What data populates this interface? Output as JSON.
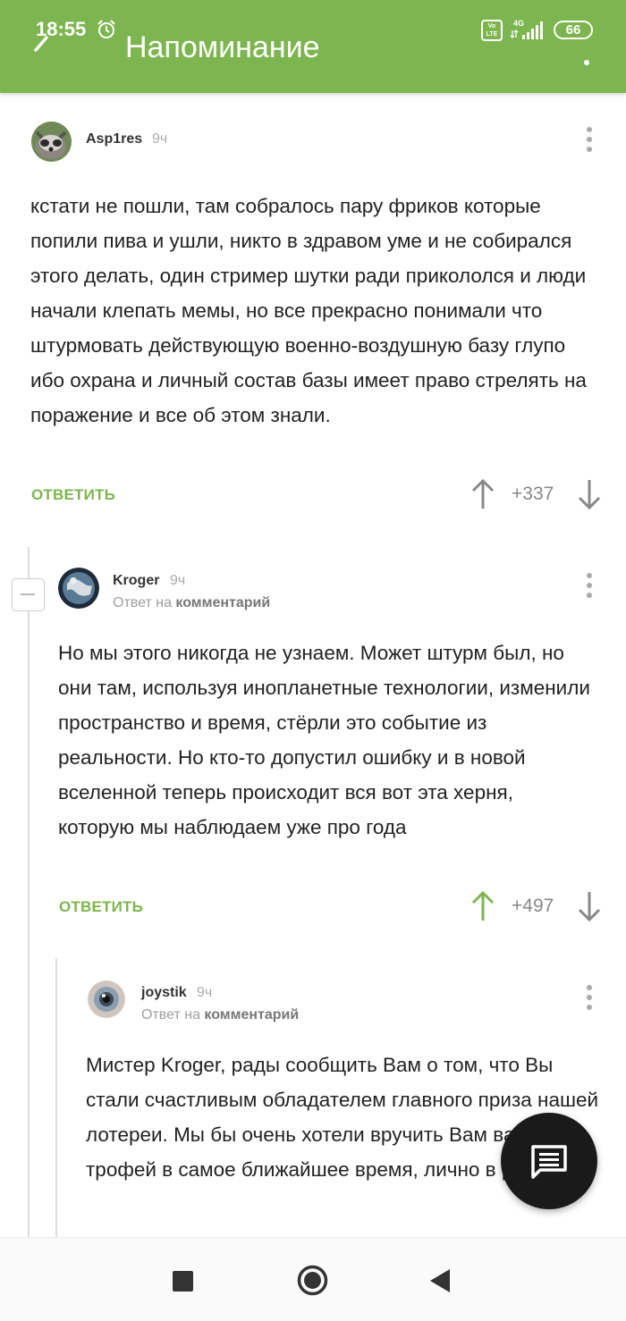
{
  "status_bar": {
    "time": "18:55",
    "battery": "66",
    "network": "4G",
    "volte_top": "Vo",
    "volte_bottom": "LTE"
  },
  "app_bar": {
    "title": "Напоминание"
  },
  "comments": [
    {
      "author": "Asp1res",
      "time": "9ч",
      "text": "кстати не пошли, там собралось пару фриков которые попили пива и ушли, никто в здравом уме и не собирался этого делать, один стример шутки ради прикололся и люди начали клепать мемы, но все прекрасно понимали что штурмовать действующую военно-воздушную базу глупо ибо охрана и личный состав базы имеет право стрелять на поражение и все об этом знали.",
      "reply_label": "ОТВЕТИТЬ",
      "rating": "+337"
    },
    {
      "author": "Kroger",
      "time": "9ч",
      "reply_to_prefix": "Ответ на",
      "reply_to_target": "комментарий",
      "text": "Но мы этого никогда не узнаем. Может штурм был, но они там, используя инопланетные технологии, изменили пространство и время, стёрли это событие из реальности. Но кто-то допустил ошибку и в новой вселенной теперь происходит вся вот эта херня, которую мы наблюдаем уже про года",
      "reply_label": "ОТВЕТИТЬ",
      "rating": "+497",
      "upvoted": true
    },
    {
      "author": "joystik",
      "time": "9ч",
      "reply_to_prefix": "Ответ на",
      "reply_to_target": "комментарий",
      "text": "Мистер Kroger, рады сообщить Вам о том, что Вы стали счастливым обладателем главного приза нашей лотереи. Мы бы очень хотели вручить Вам ваш трофей в самое ближайшее время, лично в руки."
    }
  ],
  "colors": {
    "accent": "#7db650",
    "upvote_active": "#7db650",
    "neutral_arrow": "#888888"
  },
  "icons": [
    "alarm-icon",
    "signal-icon",
    "back-icon",
    "more-vert-icon",
    "arrow-up-icon",
    "arrow-down-icon",
    "comment-fab-icon"
  ]
}
